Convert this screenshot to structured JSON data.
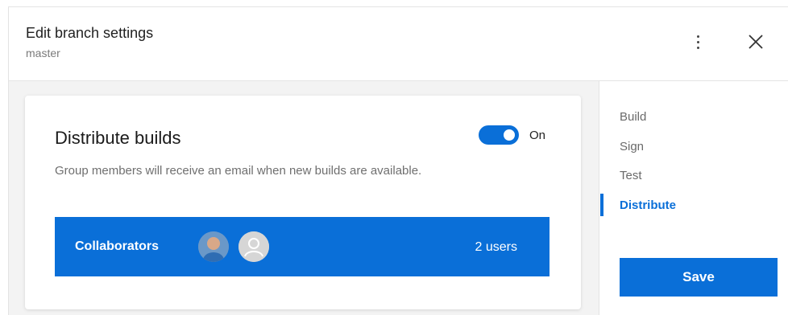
{
  "header": {
    "title": "Edit branch settings",
    "subtitle": "master",
    "more_icon": "more-vertical-icon",
    "close_icon": "close-icon"
  },
  "card": {
    "title": "Distribute builds",
    "toggle_state": "On",
    "description": "Group members will receive an email when new builds are available.",
    "collaborators": {
      "label": "Collaborators",
      "count_text": "2 users"
    }
  },
  "sidebar": {
    "items": [
      {
        "label": "Build",
        "active": false
      },
      {
        "label": "Sign",
        "active": false
      },
      {
        "label": "Test",
        "active": false
      },
      {
        "label": "Distribute",
        "active": true
      }
    ],
    "save_label": "Save"
  },
  "colors": {
    "accent": "#0a6fd8",
    "main_background": "#f3f3f3",
    "muted_text": "#6f6f6f"
  }
}
